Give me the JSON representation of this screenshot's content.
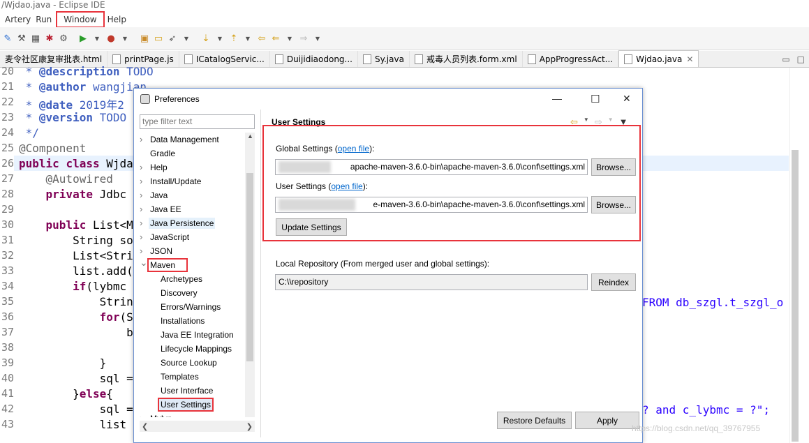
{
  "window": {
    "title": "/Wjdao.java - Eclipse IDE"
  },
  "menu": {
    "items": [
      "Artery",
      "Run",
      "Window",
      "Help"
    ]
  },
  "tabs": [
    {
      "label": "麦令社区康复审批表.html"
    },
    {
      "label": "printPage.js"
    },
    {
      "label": "ICatalogServic..."
    },
    {
      "label": "Duijidiaodong..."
    },
    {
      "label": "Sy.java"
    },
    {
      "label": "戒毒人员列表.form.xml"
    },
    {
      "label": "AppProgressAct..."
    },
    {
      "label": "Wjdao.java"
    }
  ],
  "editor": {
    "line_numbers": [
      "20",
      "21",
      "22",
      "23",
      "24",
      "25",
      "26",
      "27",
      "28",
      "29",
      "30",
      "31",
      "32",
      "33",
      "34",
      "35",
      "36",
      "37",
      "38",
      "39",
      "40",
      "41",
      "42",
      "43"
    ],
    "lines": [
      {
        "t": " * @description TODO"
      },
      {
        "t": " * @author wangjian"
      },
      {
        "t": " * @date 2019年2"
      },
      {
        "t": " * @version TODO"
      },
      {
        "t": " */"
      },
      {
        "t": "@Component"
      },
      {
        "t": "public class Wjda"
      },
      {
        "t": "    @Autowired"
      },
      {
        "t": "    private Jdbc"
      },
      {
        "t": ""
      },
      {
        "t": "    public List<M"
      },
      {
        "t": "        String so"
      },
      {
        "t": "        List<Stri"
      },
      {
        "t": "        list.add("
      },
      {
        "t": "        if(lybmc"
      },
      {
        "t": "            Strin"
      },
      {
        "t": "            for(S"
      },
      {
        "t": "                b"
      },
      {
        "t": "                "
      },
      {
        "t": "            }"
      },
      {
        "t": "            sql ="
      },
      {
        "t": "        }else{"
      },
      {
        "t": "            sql ="
      },
      {
        "t": "            list"
      }
    ],
    "right_fragment_1": "FROM db_szgl.t_szgl_o",
    "right_fragment_2": "? and c_lybmc = ?\";"
  },
  "dialog": {
    "title": "Preferences",
    "filter_placeholder": "type filter text",
    "tree": [
      {
        "label": "Data Management",
        "level": 0,
        "expandable": true
      },
      {
        "label": "Gradle",
        "level": 0,
        "expandable": false
      },
      {
        "label": "Help",
        "level": 0,
        "expandable": true
      },
      {
        "label": "Install/Update",
        "level": 0,
        "expandable": true
      },
      {
        "label": "Java",
        "level": 0,
        "expandable": true
      },
      {
        "label": "Java EE",
        "level": 0,
        "expandable": true
      },
      {
        "label": "Java Persistence",
        "level": 0,
        "expandable": true
      },
      {
        "label": "JavaScript",
        "level": 0,
        "expandable": true
      },
      {
        "label": "JSON",
        "level": 0,
        "expandable": true
      },
      {
        "label": "Maven",
        "level": 0,
        "expandable": true,
        "expanded": true
      },
      {
        "label": "Archetypes",
        "level": 1
      },
      {
        "label": "Discovery",
        "level": 1
      },
      {
        "label": "Errors/Warnings",
        "level": 1
      },
      {
        "label": "Installations",
        "level": 1
      },
      {
        "label": "Java EE Integration",
        "level": 1
      },
      {
        "label": "Lifecycle Mappings",
        "level": 1
      },
      {
        "label": "Source Lookup",
        "level": 1
      },
      {
        "label": "Templates",
        "level": 1
      },
      {
        "label": "User Interface",
        "level": 1
      },
      {
        "label": "User Settings",
        "level": 1,
        "selected": true
      },
      {
        "label": "Mylyn",
        "level": 0,
        "expandable": true
      }
    ],
    "page_title": "User Settings",
    "global_settings": {
      "label": "Global Settings (",
      "link": "open file",
      "suffix": "):",
      "value": "apache-maven-3.6.0-bin\\apache-maven-3.6.0\\conf\\settings.xml",
      "browse": "Browse..."
    },
    "user_settings": {
      "label": "User Settings (",
      "link": "open file",
      "suffix": "):",
      "value": "e-maven-3.6.0-bin\\apache-maven-3.6.0\\conf\\settings.xml",
      "browse": "Browse..."
    },
    "update_button": "Update Settings",
    "local_repo": {
      "label": "Local Repository (From merged user and global settings):",
      "value": "C:\\\\repository",
      "reindex": "Reindex"
    },
    "restore_defaults": "Restore Defaults",
    "apply": "Apply"
  },
  "watermark": "https://blog.csdn.net/qq_39767955",
  "colors": {
    "highlight": "#e8333b",
    "keyword": "#7f0055",
    "comment": "#3f5fbf",
    "string": "#2a00ff",
    "link": "#0066cc"
  }
}
